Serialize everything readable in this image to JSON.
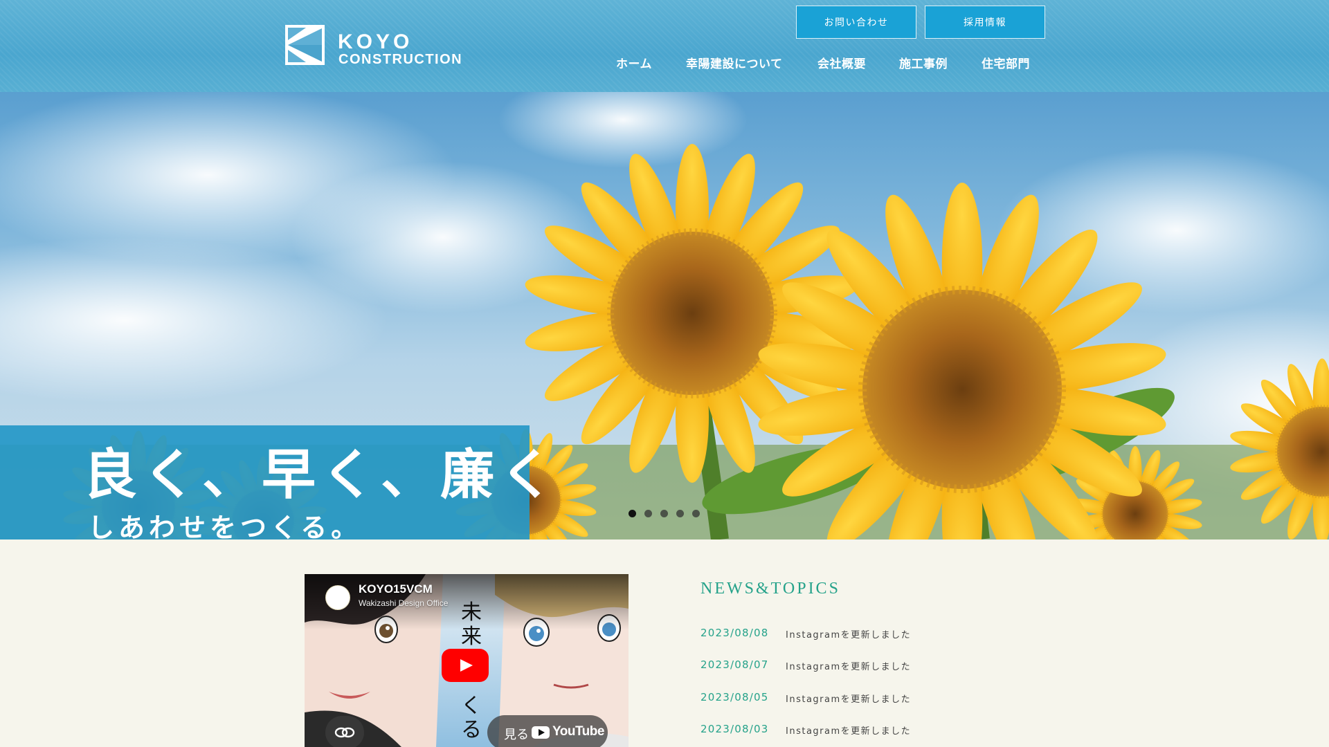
{
  "header": {
    "logo": {
      "line1": "KOYO",
      "line2": "CONSTRUCTION"
    },
    "buttons": {
      "contact": "お問い合わせ",
      "recruit": "採用情報"
    },
    "nav": [
      "ホーム",
      "幸陽建設について",
      "会社概要",
      "施工事例",
      "住宅部門"
    ]
  },
  "hero": {
    "catch_main": "良く、早く、廉く",
    "catch_sub": "しあわせをつくる。",
    "slides_total": 5,
    "active_slide": 1
  },
  "video": {
    "title": "KOYO15VCM",
    "channel": "Wakizashi Design Office",
    "thumbnail_text": "未来をつくる",
    "watch_label": "見る",
    "platform": "YouTube",
    "icons": [
      "play-icon",
      "link-icon",
      "youtube-icon"
    ]
  },
  "news": {
    "heading": "NEWS&TOPICS",
    "items": [
      {
        "date": "2023/08/08",
        "text": "Instagramを更新しました"
      },
      {
        "date": "2023/08/07",
        "text": "Instagramを更新しました"
      },
      {
        "date": "2023/08/05",
        "text": "Instagramを更新しました"
      },
      {
        "date": "2023/08/03",
        "text": "Instagramを更新しました"
      }
    ]
  },
  "colors": {
    "header_bg": "#4aa6cf",
    "button_bg": "#1aa2d6",
    "catch_bg": "#2698c7",
    "news_accent": "#25a28a",
    "page_bg": "#f6f5ec"
  }
}
